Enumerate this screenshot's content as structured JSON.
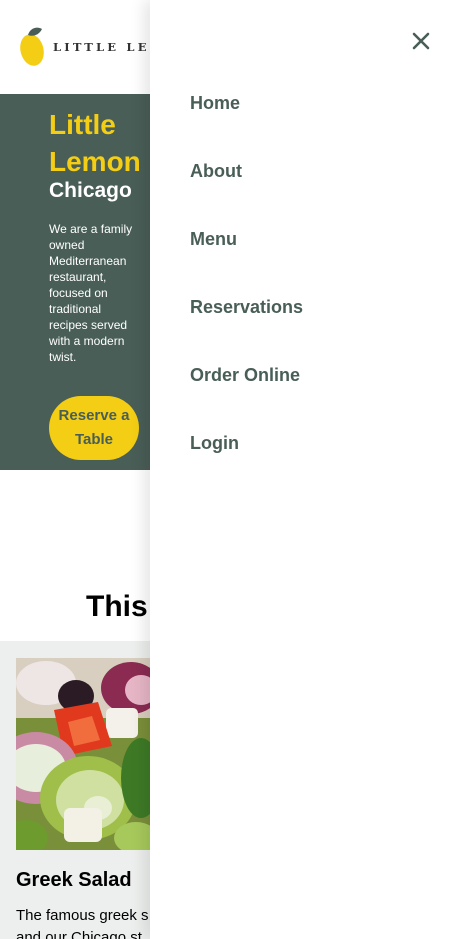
{
  "header": {
    "logo_text": "LITTLE LEMON"
  },
  "hero": {
    "title": "Little Lemon",
    "subtitle": "Chicago",
    "description": "We are a family owned Mediterranean restaurant, focused on traditional recipes served with a modern twist.",
    "cta_label": "Reserve a Table"
  },
  "specials": {
    "heading": "This",
    "card": {
      "title": "Greek Salad",
      "description": "The famous greek s",
      "description_line2": "and our Chicago st"
    }
  },
  "menu": {
    "close_icon": "close-icon",
    "items": [
      {
        "label": "Home"
      },
      {
        "label": "About"
      },
      {
        "label": "Menu"
      },
      {
        "label": "Reservations"
      },
      {
        "label": "Order Online"
      },
      {
        "label": "Login"
      }
    ]
  },
  "colors": {
    "primary_green": "#495e57",
    "primary_yellow": "#f4ce14",
    "light_band": "#edefee"
  }
}
